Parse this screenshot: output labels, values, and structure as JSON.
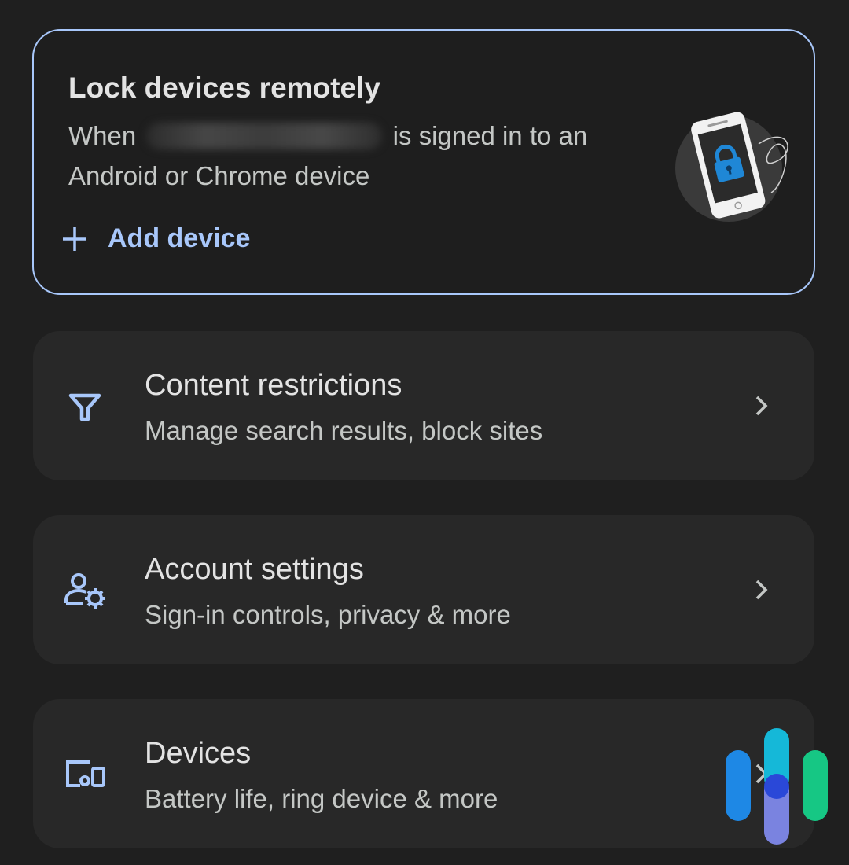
{
  "lock_card": {
    "title": "Lock devices remotely",
    "desc_prefix": "When",
    "desc_suffix": "is signed in to an Android or Chrome device",
    "add_device_label": "Add device"
  },
  "menu": [
    {
      "title": "Content restrictions",
      "subtitle": "Manage search results, block sites",
      "icon": "filter-icon"
    },
    {
      "title": "Account settings",
      "subtitle": "Sign-in controls, privacy & more",
      "icon": "account-settings-icon"
    },
    {
      "title": "Devices",
      "subtitle": "Battery life, ring device & more",
      "icon": "devices-icon"
    }
  ],
  "colors": {
    "background": "#1f1f1f",
    "card": "#282828",
    "accent": "#a8c7fa",
    "primary_text": "#e3e3e3",
    "secondary_text": "#c4c7c5"
  }
}
